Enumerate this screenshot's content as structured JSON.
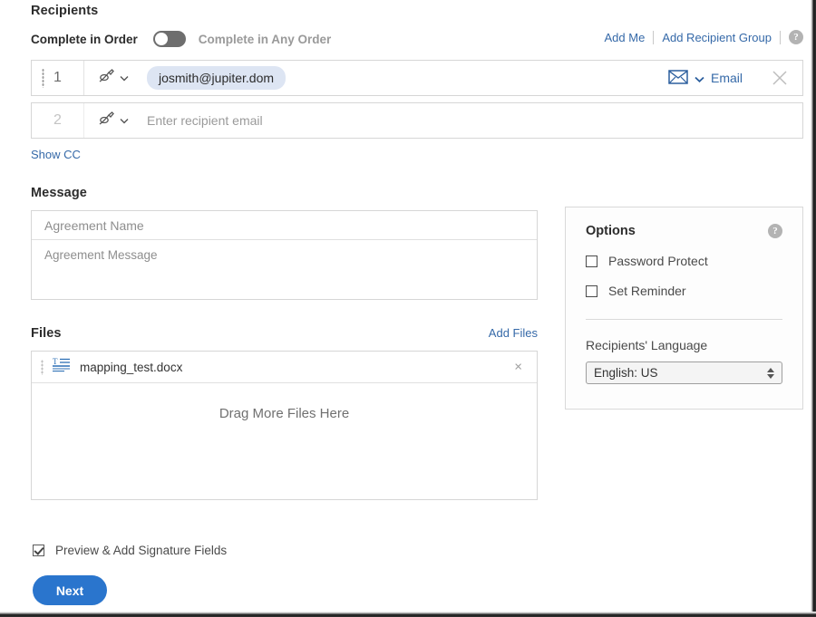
{
  "recipients": {
    "title": "Recipients",
    "complete_in_order_label": "Complete in Order",
    "complete_in_any_order_label": "Complete in Any Order",
    "order_toggle_state": "off",
    "add_me_label": "Add Me",
    "add_recipient_group_label": "Add Recipient Group",
    "help_glyph": "?",
    "show_cc_label": "Show CC",
    "rows": [
      {
        "number": "1",
        "role_icon": "signature-pen-icon",
        "email": "josmith@jupiter.dom",
        "channel": "Email",
        "channel_icon": "envelope-icon",
        "has_drag_handle": true,
        "has_close": true
      },
      {
        "number": "2",
        "role_icon": "signature-pen-icon",
        "email_placeholder": "Enter recipient email",
        "has_drag_handle": false,
        "has_close": false
      }
    ]
  },
  "message": {
    "title": "Message",
    "agreement_name_placeholder": "Agreement Name",
    "agreement_message_placeholder": "Agreement Message"
  },
  "options": {
    "title": "Options",
    "help_glyph": "?",
    "password_protect_label": "Password Protect",
    "password_protect_checked": false,
    "set_reminder_label": "Set Reminder",
    "set_reminder_checked": false,
    "recipients_language_label": "Recipients' Language",
    "language_value": "English: US"
  },
  "files": {
    "title": "Files",
    "add_files_label": "Add Files",
    "items": [
      {
        "name": "mapping_test.docx",
        "icon": "text-document-icon",
        "close_glyph": "×"
      }
    ],
    "drop_zone_label": "Drag More Files Here"
  },
  "footer": {
    "preview_label": "Preview & Add Signature Fields",
    "preview_checked": true,
    "next_label": "Next"
  },
  "colors": {
    "link_blue": "#3569a8",
    "button_blue": "#2a75cd",
    "chip_blue": "#dde5f3",
    "toggle_grey": "#6e6e6e"
  }
}
